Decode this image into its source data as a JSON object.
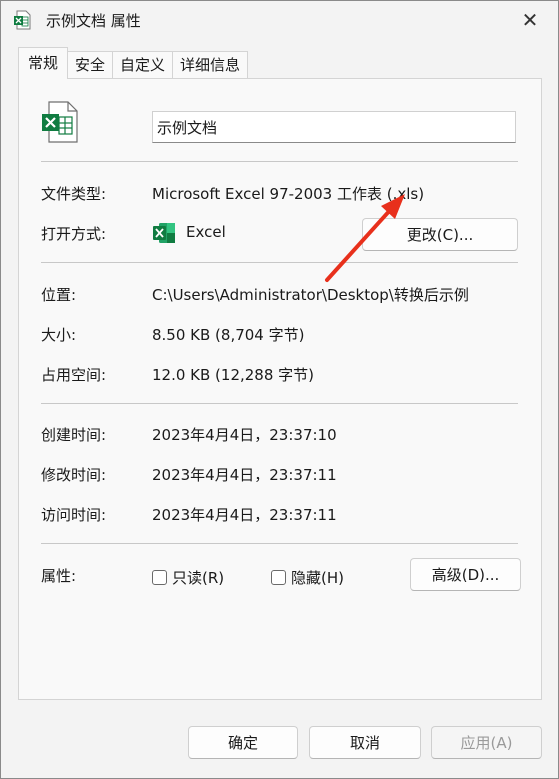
{
  "window": {
    "title": "示例文档 属性",
    "close_glyph": "✕"
  },
  "tabs": [
    {
      "label": "常规",
      "active": true
    },
    {
      "label": "安全",
      "active": false
    },
    {
      "label": "自定义",
      "active": false
    },
    {
      "label": "详细信息",
      "active": false
    }
  ],
  "general": {
    "file_name": "示例文档",
    "file_type_label": "文件类型:",
    "file_type_value": "Microsoft Excel 97-2003 工作表 (.xls)",
    "open_with_label": "打开方式:",
    "open_with_app": "Excel",
    "change_button": "更改(C)...",
    "location_label": "位置:",
    "location_value": "C:\\Users\\Administrator\\Desktop\\转换后示例",
    "size_label": "大小:",
    "size_value": "8.50 KB (8,704 字节)",
    "size_on_disk_label": "占用空间:",
    "size_on_disk_value": "12.0 KB (12,288 字节)",
    "created_label": "创建时间:",
    "created_value": "2023年4月4日，23:37:10",
    "modified_label": "修改时间:",
    "modified_value": "2023年4月4日，23:37:11",
    "accessed_label": "访问时间:",
    "accessed_value": "2023年4月4日，23:37:11",
    "attributes_label": "属性:",
    "readonly_label": "只读(R)",
    "readonly_checked": false,
    "hidden_label": "隐藏(H)",
    "hidden_checked": false,
    "advanced_button": "高级(D)..."
  },
  "footer": {
    "ok_button": "确定",
    "cancel_button": "取消",
    "apply_button": "应用(A)"
  },
  "colors": {
    "excel_green": "#107c41",
    "annotation_arrow": "#e8301c"
  },
  "icons": {
    "title": "excel-file-icon",
    "file": "excel-document-icon",
    "app": "excel-app-icon",
    "close": "close-icon",
    "annotation": "red-arrow-annotation"
  }
}
